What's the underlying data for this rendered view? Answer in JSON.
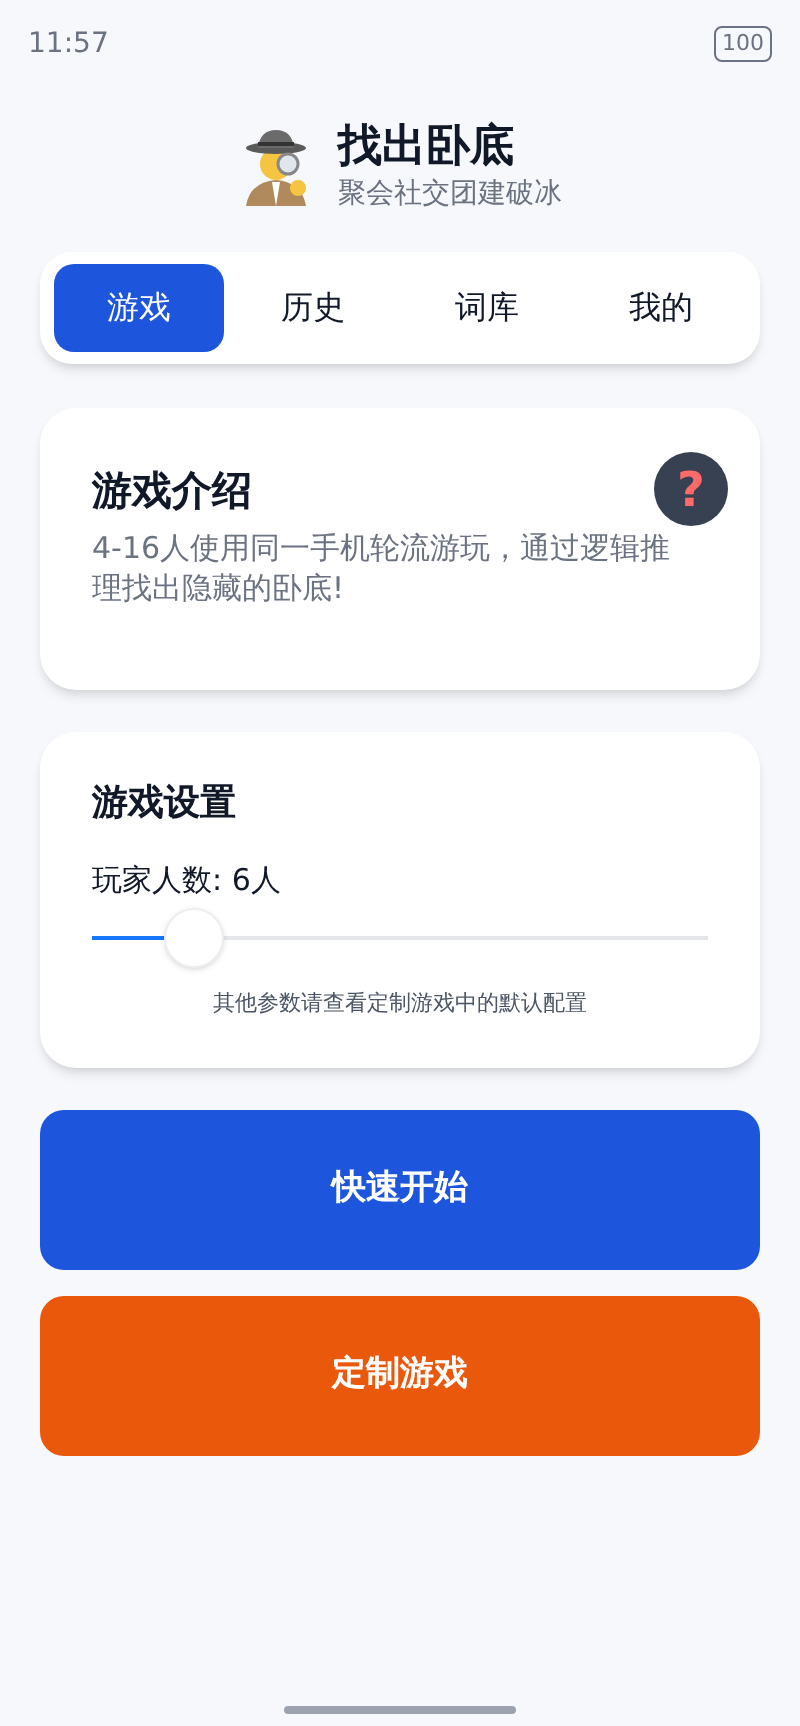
{
  "status_bar": {
    "time": "11:57",
    "battery": "100"
  },
  "header": {
    "title": "找出卧底",
    "subtitle": "聚会社交团建破冰"
  },
  "tabs": [
    {
      "label": "游戏",
      "selected": true
    },
    {
      "label": "历史",
      "selected": false
    },
    {
      "label": "词库",
      "selected": false
    },
    {
      "label": "我的",
      "selected": false
    }
  ],
  "intro": {
    "title": "游戏介绍",
    "help": "?",
    "text": "4-16人使用同一手机轮流游玩，通过逻辑推理找出隐藏的卧底!"
  },
  "settings": {
    "title": "游戏设置",
    "players_label": "玩家人数: 6人",
    "players": {
      "level": 0.166
    },
    "note": "其他参数请查看定制游戏中的默认配置"
  },
  "buttons": [
    {
      "label": "快速开始",
      "kind": "primary"
    },
    {
      "label": "定制游戏",
      "kind": "custom"
    }
  ]
}
